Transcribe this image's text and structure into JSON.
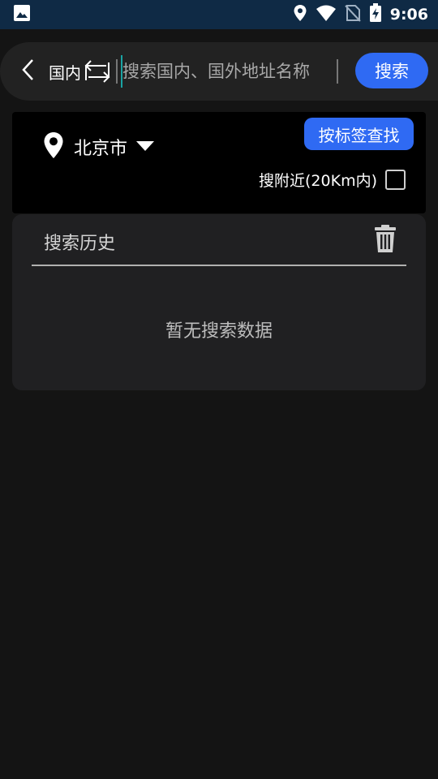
{
  "status_bar": {
    "time": "9:06",
    "icons": [
      "image-icon",
      "location-icon",
      "wifi-icon",
      "no-sim-icon",
      "battery-charging-icon"
    ]
  },
  "search_bar": {
    "region_label": "国内",
    "placeholder": "搜索国内、国外地址名称",
    "search_label": "搜索",
    "icons": [
      "back-arrow-icon",
      "swap-icon"
    ]
  },
  "filter": {
    "city": "北京市",
    "tag_button_label": "按标签查找",
    "nearby_label": "搜附近(20Km内)",
    "nearby_checked": false,
    "icons": [
      "location-pin-icon",
      "caret-down-icon"
    ]
  },
  "history": {
    "title": "搜索历史",
    "empty_text": "暂无搜索数据",
    "icons": [
      "trash-icon"
    ]
  },
  "colors": {
    "background": "#141414",
    "status_bar": "#0f2a45",
    "accent": "#2f6af3",
    "panel": "#202022",
    "cursor": "#1aa3a3"
  }
}
